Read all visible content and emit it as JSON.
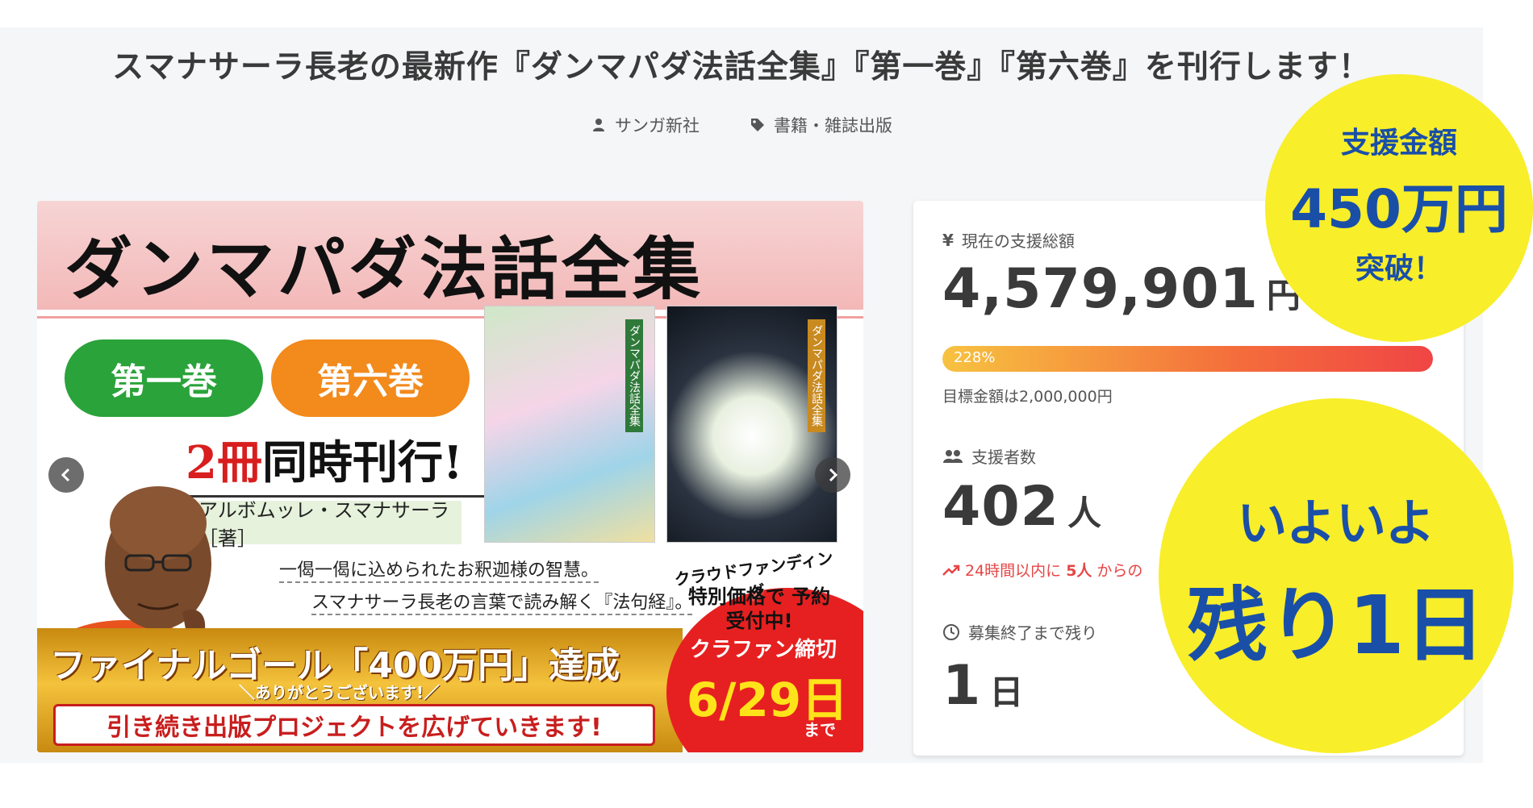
{
  "header": {
    "title": "スマナサーラ長老の最新作『ダンマパダ法話全集』『第一巻』『第六巻』を刊行します！",
    "author_icon": "user-icon",
    "author": "サンガ新社",
    "category_icon": "tag-icon",
    "category": "書籍・雑誌出版"
  },
  "hero": {
    "title": "ダンマパダ法話全集",
    "volume1": "第一巻",
    "volume6": "第六巻",
    "simul_num": "2冊",
    "simul_text": "同時刊行!",
    "author": "アルボムッレ・スマナサーラ［著］",
    "tagline1": "一偈一偈に込められたお釈迦様の智慧。",
    "tagline2": "スマナサーラ長老の言葉で読み解く『法句経』。",
    "book_spine1": "ダンマパダ法話全集",
    "book_spine2": "ダンマパダ法話全集",
    "goal": "ファイナルゴール「400万円」達成",
    "thanks": "＼ありがとうございます!／",
    "continue": "引き続き出版プロジェクトを広げていきます!",
    "cf_label": "クラウドファンディング",
    "cf_price": "特別価格で 予約受付中!",
    "cf_deadline": "クラファン締切",
    "cf_date": "6/29日",
    "cf_made": "まで",
    "prev_icon": "chevron-left-icon",
    "next_icon": "chevron-right-icon"
  },
  "stats": {
    "total_label": "現在の支援総額",
    "total_icon": "yen-icon",
    "total_value": "4,579,901",
    "total_unit": "円",
    "progress_label": "228%",
    "progress_fraction": 1.0,
    "goal_note": "目標金額は2,000,000円",
    "backers_icon": "users-icon",
    "backers_label": "支援者数",
    "backers_value": "402",
    "backers_unit": "人",
    "recent_icon": "trend-up-icon",
    "recent_prefix": "24時間以内に",
    "recent_count": "5人",
    "recent_suffix": "からの",
    "remaining_icon": "clock-icon",
    "remaining_label": "募集終了まで残り",
    "remaining_value": "1",
    "remaining_unit": "日"
  },
  "badges": {
    "amount_line1": "支援金額",
    "amount_line2": "450万円",
    "amount_line3": "突破！",
    "last_line1": "いよいよ",
    "last_line2": "残り1日"
  },
  "colors": {
    "yellow_badge": "#f8ee2a",
    "badge_text": "#1a4fa8",
    "progress_start": "#f7c240",
    "progress_end": "#f04545",
    "alert": "#e64545"
  }
}
